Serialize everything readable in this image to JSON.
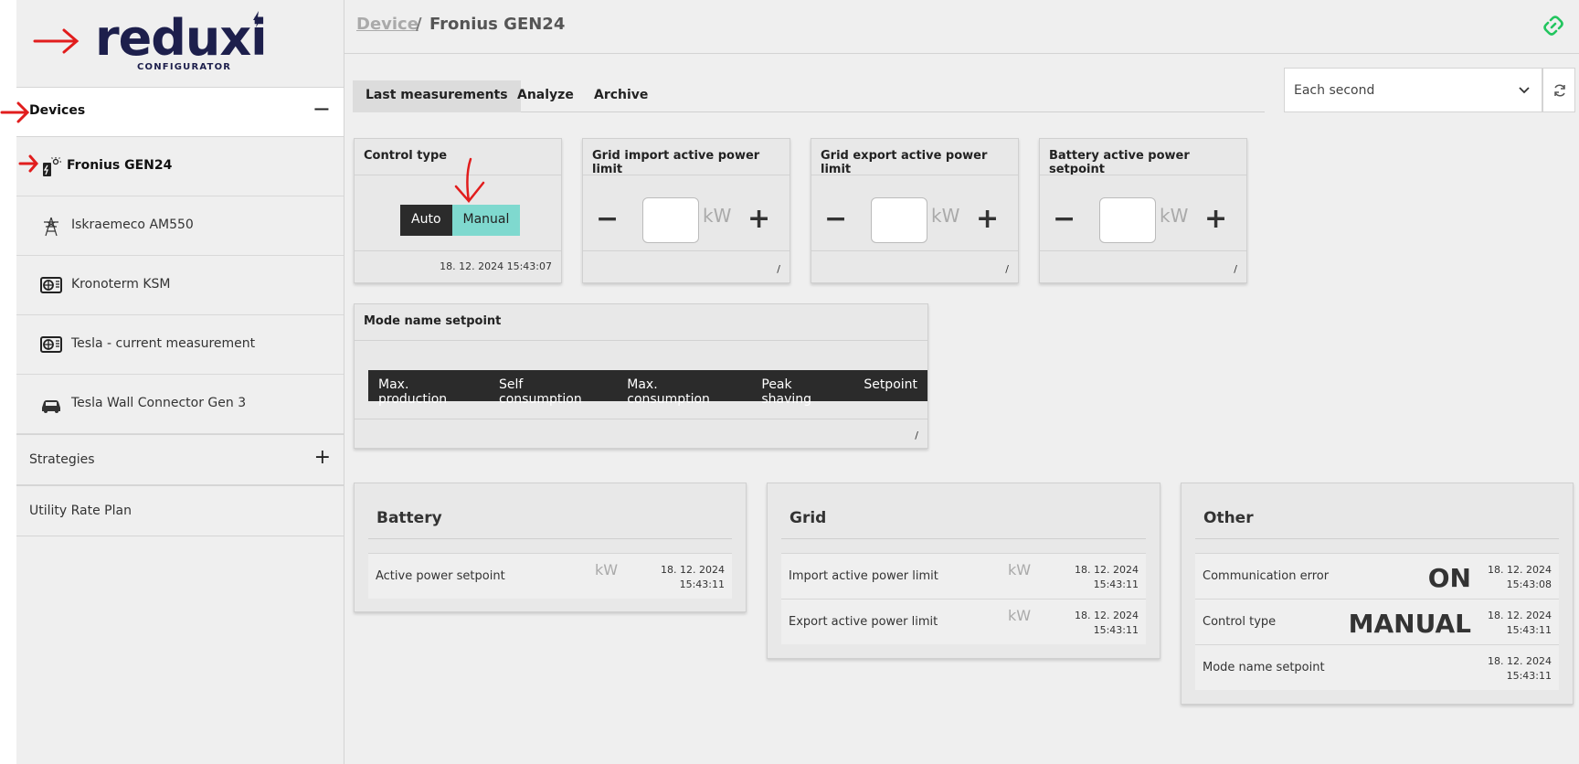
{
  "logo": {
    "word": "reduxi",
    "sub": "CONFIGURATOR"
  },
  "sidebar": {
    "devices_label": "Devices",
    "devices_toggle": "−",
    "devices": [
      {
        "label": "Fronius GEN24",
        "icon": "inverter-icon"
      },
      {
        "label": "Iskraemeco AM550",
        "icon": "power-tower-icon"
      },
      {
        "label": "Kronoterm KSM",
        "icon": "heat-pump-icon"
      },
      {
        "label": "Tesla - current measurement",
        "icon": "heat-pump-icon"
      },
      {
        "label": "Tesla Wall Connector Gen 3",
        "icon": "car-icon"
      }
    ],
    "strategies_label": "Strategies",
    "strategies_toggle": "+",
    "utility_label": "Utility Rate Plan"
  },
  "header": {
    "crumb_link": "Device",
    "crumb_sep": "/",
    "crumb_current": "Fronius GEN24"
  },
  "tabs": [
    "Last measurements",
    "Analyze",
    "Archive"
  ],
  "interval": {
    "value": "Each second"
  },
  "control_card": {
    "title": "Control type",
    "options": [
      "Auto",
      "Manual"
    ],
    "selected": "Manual",
    "timestamp": "18. 12. 2024 15:43:07"
  },
  "steppers": [
    {
      "title": "Grid import active power limit",
      "unit": "kW",
      "footer": "/"
    },
    {
      "title": "Grid export active power limit",
      "unit": "kW",
      "footer": "/"
    },
    {
      "title": "Battery active power setpoint",
      "unit": "kW",
      "footer": "/"
    }
  ],
  "stepper_minus": "−",
  "stepper_plus": "+",
  "mode_card": {
    "title": "Mode name setpoint",
    "options": [
      "Max. production",
      "Self consumption",
      "Max. consumption",
      "Peak shaving",
      "Setpoint"
    ],
    "footer": "/"
  },
  "battery_panel": {
    "title": "Battery",
    "rows": [
      {
        "label": "Active power setpoint",
        "unit": "kW",
        "date": "18. 12. 2024",
        "time": "15:43:11"
      }
    ]
  },
  "grid_panel": {
    "title": "Grid",
    "rows": [
      {
        "label": "Import active power limit",
        "unit": "kW",
        "date": "18. 12. 2024",
        "time": "15:43:11"
      },
      {
        "label": "Export active power limit",
        "unit": "kW",
        "date": "18. 12. 2024",
        "time": "15:43:11"
      }
    ]
  },
  "other_panel": {
    "title": "Other",
    "rows": [
      {
        "label": "Communication error",
        "value": "ON",
        "date": "18. 12. 2024",
        "time": "15:43:08"
      },
      {
        "label": "Control type",
        "value": "MANUAL",
        "date": "18. 12. 2024",
        "time": "15:43:11"
      },
      {
        "label": "Mode name setpoint",
        "value": "",
        "date": "18. 12. 2024",
        "time": "15:43:11"
      }
    ]
  },
  "colors": {
    "brand": "#1d1f4c",
    "selected": "#7fd9cf",
    "link_icon": "#22c55e",
    "annotation": "#e11d1d"
  }
}
